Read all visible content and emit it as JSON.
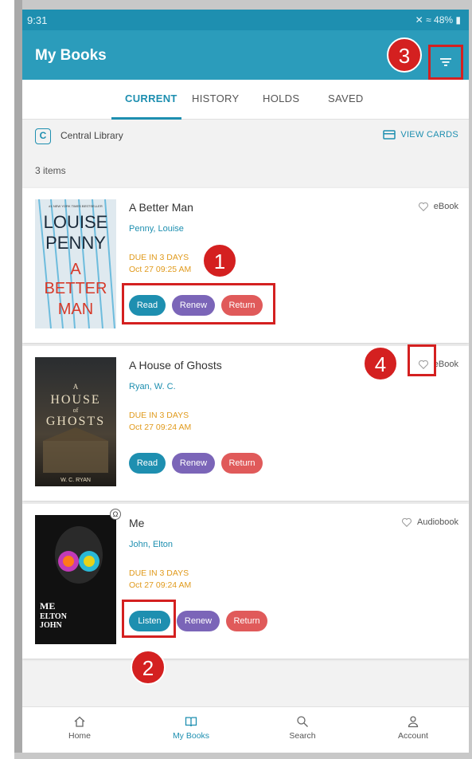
{
  "status": {
    "time": "9:31",
    "battery": "48%"
  },
  "app": {
    "title": "My Books"
  },
  "tabs": [
    {
      "label": "CURRENT",
      "active": true
    },
    {
      "label": "HISTORY",
      "active": false
    },
    {
      "label": "HOLDS",
      "active": false
    },
    {
      "label": "SAVED",
      "active": false
    }
  ],
  "library": {
    "name": "Central Library",
    "view_cards": "VIEW CARDS",
    "icon_letter": "C"
  },
  "items_count": "3 items",
  "books": [
    {
      "title": "A Better Man",
      "author": "Penny, Louise",
      "due_label": "DUE IN 3 DAYS",
      "due_date": "Oct 27 09:25 AM",
      "format": "eBook",
      "buttons": [
        "Read",
        "Renew",
        "Return"
      ],
      "cover": {
        "line1": "LOUISE",
        "line2": "PENNY",
        "line3": "A",
        "line4": "BETTER",
        "line5": "MAN",
        "tagline": "#1 NEW YORK TIMES BESTSELLER"
      }
    },
    {
      "title": "A House of Ghosts",
      "author": "Ryan, W. C.",
      "due_label": "DUE IN 3 DAYS",
      "due_date": "Oct 27 09:24 AM",
      "format": "eBook",
      "buttons": [
        "Read",
        "Renew",
        "Return"
      ],
      "cover": {
        "line1": "A",
        "line2": "HOUSE",
        "line3": "of",
        "line4": "GHOSTS",
        "line5": "W. C. RYAN"
      }
    },
    {
      "title": "Me",
      "author": "John, Elton",
      "due_label": "DUE IN 3 DAYS",
      "due_date": "Oct 27 09:24 AM",
      "format": "Audiobook",
      "buttons": [
        "Listen",
        "Renew",
        "Return"
      ],
      "cover": {
        "line1": "ME",
        "line2": "ELTON",
        "line3": "JOHN"
      }
    }
  ],
  "callouts": [
    "1",
    "2",
    "3",
    "4"
  ],
  "nav": [
    {
      "label": "Home",
      "icon": "home-icon",
      "active": false
    },
    {
      "label": "My Books",
      "icon": "book-icon",
      "active": true
    },
    {
      "label": "Search",
      "icon": "search-icon",
      "active": false
    },
    {
      "label": "Account",
      "icon": "account-icon",
      "active": false
    }
  ],
  "colors": {
    "primary": "#2b9cbb",
    "accent": "#1e8fb0",
    "renew": "#7b65b8",
    "return": "#e05a5a",
    "due": "#e09a1c",
    "callout": "#d42020"
  }
}
